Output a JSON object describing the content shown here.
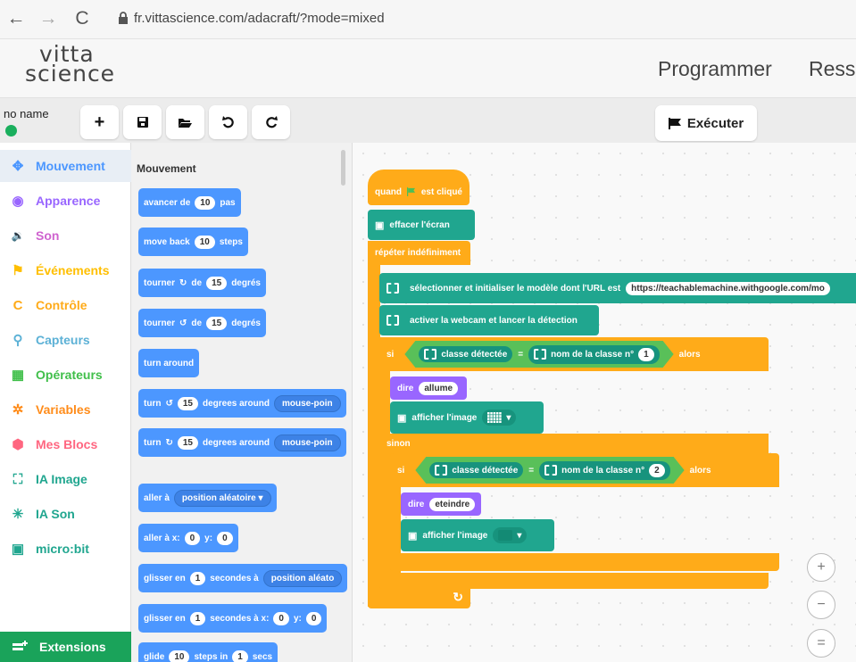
{
  "browser": {
    "back": "←",
    "forward": "→",
    "reload": "C",
    "url": "fr.vittascience.com/adacraft/?mode=mixed"
  },
  "header": {
    "logo_line1": "vitta",
    "logo_line2": "science",
    "nav": [
      "Programmer",
      "Ress"
    ]
  },
  "toolbar": {
    "project_name": "no name",
    "run_label": "Exécuter"
  },
  "categories": [
    {
      "label": "Mouvement",
      "color": "#4c97ff",
      "icon": "✥"
    },
    {
      "label": "Apparence",
      "color": "#9966ff",
      "icon": "◉"
    },
    {
      "label": "Son",
      "color": "#cf63cf",
      "icon": "🔉"
    },
    {
      "label": "Événements",
      "color": "#ffbf00",
      "icon": "⚑"
    },
    {
      "label": "Contrôle",
      "color": "#ffab19",
      "icon": "C"
    },
    {
      "label": "Capteurs",
      "color": "#5cb1d6",
      "icon": "⚲"
    },
    {
      "label": "Opérateurs",
      "color": "#40bf4a",
      "icon": "▦"
    },
    {
      "label": "Variables",
      "color": "#ff8c1a",
      "icon": "✲"
    },
    {
      "label": "Mes Blocs",
      "color": "#ff6680",
      "icon": "⬢"
    },
    {
      "label": "IA Image",
      "color": "#20a68f",
      "icon": "⛶"
    },
    {
      "label": "IA Son",
      "color": "#20a68f",
      "icon": "✳"
    },
    {
      "label": "micro:bit",
      "color": "#20a68f",
      "icon": "▣"
    }
  ],
  "extensions_label": "Extensions",
  "flyout": {
    "title": "Mouvement",
    "b1": {
      "a": "avancer de",
      "v": "10",
      "b": "pas"
    },
    "b2": {
      "a": "move back",
      "v": "10",
      "b": "steps"
    },
    "b3": {
      "a": "tourner",
      "d": "de",
      "v": "15",
      "b": "degrés"
    },
    "b4": {
      "a": "tourner",
      "d": "de",
      "v": "15",
      "b": "degrés"
    },
    "b5": {
      "a": "turn around"
    },
    "b6": {
      "a": "turn",
      "v": "15",
      "b": "degrees around",
      "dd": "mouse-poin"
    },
    "b7": {
      "a": "turn",
      "v": "15",
      "b": "degrees around",
      "dd": "mouse-poin"
    },
    "b8": {
      "a": "aller à",
      "dd": "position aléatoire ▾"
    },
    "b9": {
      "a": "aller à x:",
      "x": "0",
      "y_lbl": "y:",
      "y": "0"
    },
    "b10": {
      "a": "glisser en",
      "v": "1",
      "b": "secondes à",
      "dd": "position aléato"
    },
    "b11": {
      "a": "glisser en",
      "v": "1",
      "b": "secondes à x:",
      "x": "0",
      "y_lbl": "y:",
      "y": "0"
    },
    "b12": {
      "a": "glide",
      "v": "10",
      "b": "steps in",
      "v2": "1",
      "c": "secs"
    }
  },
  "script": {
    "hat": "quand",
    "hat_b": "est cliqué",
    "clear": "effacer l'écran",
    "forever": "répéter indéfiniment",
    "select_model": "sélectionner et initialiser le modèle dont l'URL est",
    "model_url": "https://teachablemachine.withgoogle.com/mo",
    "webcam": "activer la webcam et lancer la détection",
    "if1": {
      "si": "si",
      "detected": "classe détectée",
      "eq": "=",
      "class_name": "nom de la classe n°",
      "n": "1",
      "then": "alors"
    },
    "say1": {
      "label": "dire",
      "value": "allume"
    },
    "show1": "afficher l'image",
    "else": "sinon",
    "if2": {
      "si": "si",
      "detected": "classe détectée",
      "eq": "=",
      "class_name": "nom de la classe n°",
      "n": "2",
      "then": "alors"
    },
    "say2": {
      "label": "dire",
      "value": "eteindre"
    },
    "show2": "afficher l'image",
    "loop_arrow": "↻"
  },
  "zoom": {
    "in": "+",
    "out": "−",
    "reset": "="
  }
}
